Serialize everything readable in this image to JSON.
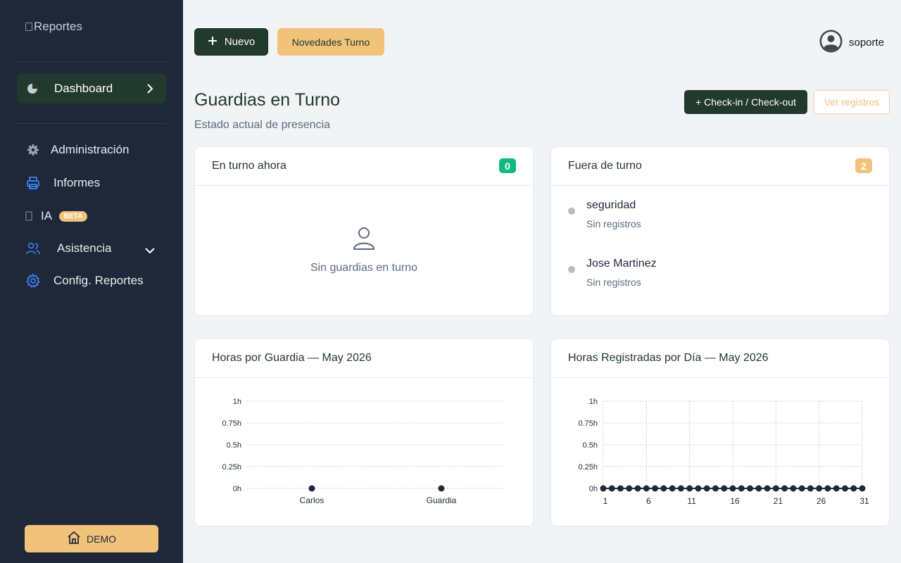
{
  "sidebar": {
    "logo_alt": "Reportes",
    "dashboard_label": "Dashboard",
    "items": [
      {
        "label": "Administración",
        "icon": "gear-icon"
      },
      {
        "label": "Informes",
        "icon": "printer-icon"
      },
      {
        "label": "IA",
        "icon": "ai-icon",
        "badge": "BETA"
      },
      {
        "label": "Asistencia",
        "icon": "users-icon"
      },
      {
        "label": "Config. Reportes",
        "icon": "settings-icon"
      }
    ],
    "demo_label": "DEMO"
  },
  "topbar": {
    "new_label": "Nuevo",
    "novedades_label": "Novedades Turno",
    "username": "soporte"
  },
  "header": {
    "title": "Guardias en Turno",
    "subtitle": "Estado actual de presencia",
    "checkin_label": "+ Check-in / Check-out",
    "records_label": "Ver registros"
  },
  "cards": {
    "on_duty": {
      "title": "En turno ahora",
      "count": "0",
      "empty_text": "Sin guardias en turno"
    },
    "off_duty": {
      "title": "Fuera de turno",
      "count": "2",
      "people": [
        {
          "name": "seguridad",
          "status": "Sin registros"
        },
        {
          "name": "Jose Martinez",
          "status": "Sin registros"
        }
      ]
    },
    "hours_by_guard": {
      "title": "Horas por Guardia — May 2026"
    },
    "hours_by_day": {
      "title": "Horas Registradas por Día — May 2026"
    }
  },
  "colors": {
    "sidebar": "#1e2838",
    "primary": "#22392d",
    "accent": "#f0c27a",
    "success": "#10b981",
    "point": "#1e2838"
  },
  "chart_data": [
    {
      "type": "scatter",
      "title": "Horas por Guardia — May 2026",
      "categories": [
        "Carlos",
        "Guardia"
      ],
      "values": [
        0,
        0
      ],
      "yticks": [
        "0h",
        "0.25h",
        "0.5h",
        "0.75h",
        "1h"
      ],
      "ylim": [
        0,
        1
      ],
      "grid": "horizontal"
    },
    {
      "type": "line",
      "title": "Horas Registradas por Día — May 2026",
      "x": [
        1,
        2,
        3,
        4,
        5,
        6,
        7,
        8,
        9,
        10,
        11,
        12,
        13,
        14,
        15,
        16,
        17,
        18,
        19,
        20,
        21,
        22,
        23,
        24,
        25,
        26,
        27,
        28,
        29,
        30,
        31
      ],
      "values": [
        0,
        0,
        0,
        0,
        0,
        0,
        0,
        0,
        0,
        0,
        0,
        0,
        0,
        0,
        0,
        0,
        0,
        0,
        0,
        0,
        0,
        0,
        0,
        0,
        0,
        0,
        0,
        0,
        0,
        0,
        0
      ],
      "xticks": [
        "1",
        "6",
        "11",
        "16",
        "21",
        "26",
        "31"
      ],
      "yticks": [
        "0h",
        "0.25h",
        "0.5h",
        "0.75h",
        "1h"
      ],
      "ylim": [
        0,
        1
      ],
      "grid": "both"
    }
  ]
}
